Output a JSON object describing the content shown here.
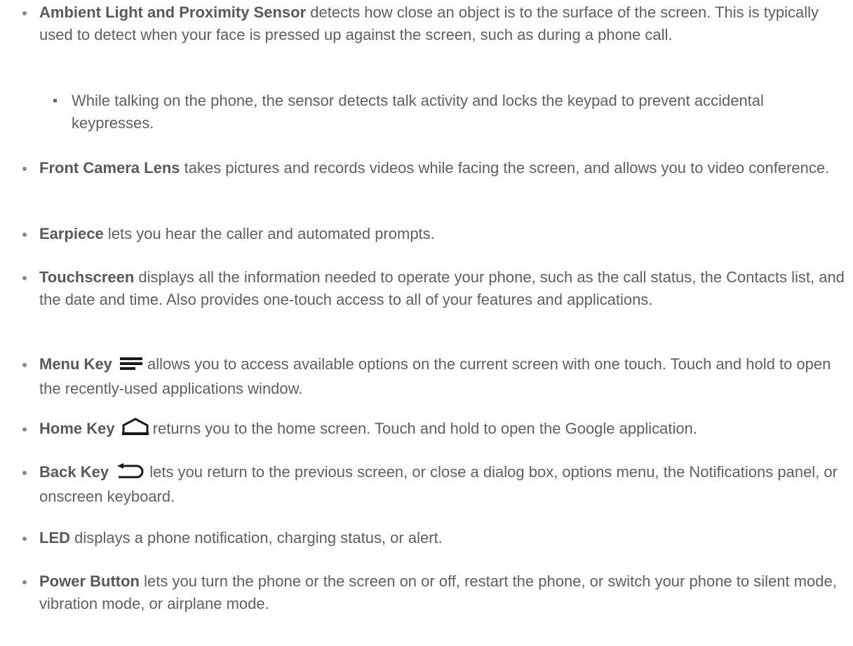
{
  "items": [
    {
      "term": "Ambient Light and Proximity Sensor",
      "text": " detects how close an object is to the surface of the screen. This is typically used to detect when your face is pressed up against the screen, such as during a phone call."
    },
    {
      "text": "While talking on the phone, the sensor detects talk activity and locks the keypad to prevent accidental keypresses."
    },
    {
      "term": "Front Camera Lens",
      "text": " takes pictures and records videos while facing the screen, and allows you to video conference."
    },
    {
      "term": "Earpiece",
      "text": " lets you hear the caller and automated prompts."
    },
    {
      "term": "Touchscreen",
      "text": " displays all the information needed to operate your phone, such as the call status, the Contacts list, and the date and time. Also provides one-touch access to all of your features and applications."
    },
    {
      "term": "Menu Key",
      "icon": "menu-key-icon",
      "text": "allows you to access available options on the current screen with one touch. Touch and hold to open the recently-used applications window."
    },
    {
      "term": "Home Key",
      "icon": "home-key-icon",
      "text": "returns you to the home screen. Touch and hold to open the Google application."
    },
    {
      "term": "Back Key",
      "icon": "back-key-icon",
      "text": "lets you return to the previous screen, or close a dialog box, options menu, the Notifications panel, or onscreen keyboard."
    },
    {
      "term": "LED",
      "text": " displays a phone notification, charging status, or alert."
    },
    {
      "term": "Power Button",
      "text": " lets you turn the phone or the screen on or off, restart the phone, or switch your phone to silent mode, vibration mode, or airplane mode."
    }
  ],
  "colors": {
    "text": "#5f5f5f",
    "icon": "#1a1a1a"
  }
}
